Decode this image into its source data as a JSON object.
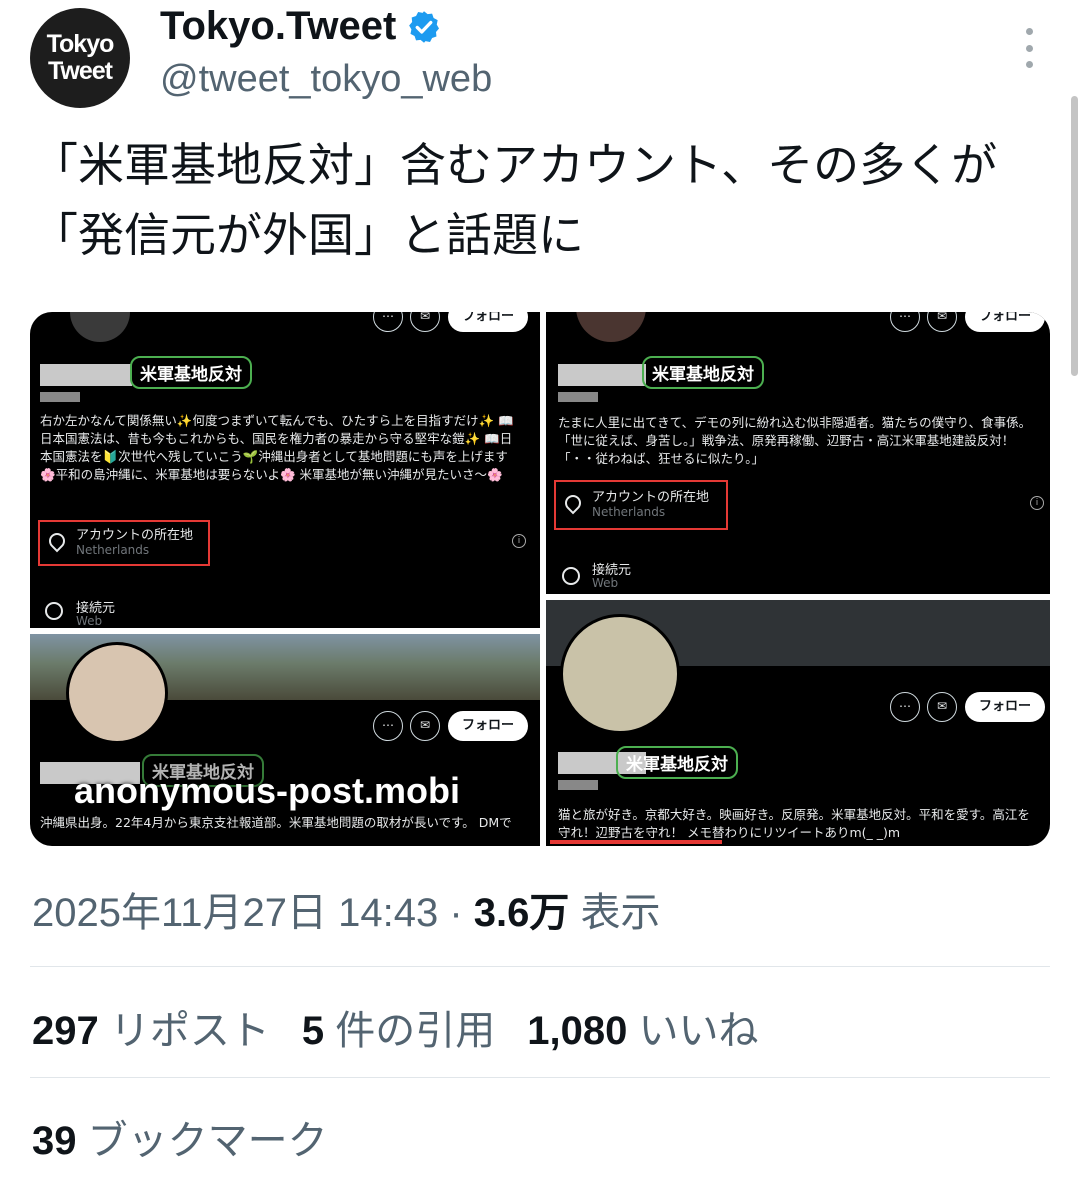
{
  "author": {
    "logo_line1": "Tokyo",
    "logo_line2": "Tweet",
    "display_name": "Tokyo.Tweet",
    "handle": "@tweet_tokyo_web"
  },
  "tweet_text": "「米軍基地反対」含むアカウント、その多くが「発信元が外国」と話題に",
  "media": {
    "tag_label": "米軍基地反対",
    "follow_label": "フォロー",
    "watermark": "anonymous-post.mobi",
    "location_title": "アカウントの所在地",
    "location_value": "Netherlands",
    "connection_title": "接続元",
    "connection_value": "Web",
    "panel1_bio": "右か左かなんて関係無い✨何度つまずいて転んでも、ひたすら上を目指すだけ✨ 📖日本国憲法は、昔も今もこれからも、国民を権力者の暴走から守る堅牢な鎧✨ 📖日本国憲法を🔰次世代へ残していこう🌱沖縄出身者として基地問題にも声を上げます🌸平和の島沖縄に、米軍基地は要らないよ🌸 米軍基地が無い沖縄が見たいさ〜🌸",
    "panel2_bio": "たまに人里に出てきて、デモの列に紛れ込む似非隠遁者。猫たちの僕守り、食事係。「世に従えば、身苦し。」戦争法、原発再稼働、辺野古・高江米軍基地建設反対！「・・従わねば、狂せるに似たり。」",
    "panel3_bio": "沖縄県出身。22年4月から東京支社報道部。米軍基地問題の取材が長いです。 DMで",
    "panel4_bio": "猫と旅が好き。京都大好き。映画好き。反原発。米軍基地反対。平和を愛す。高江を守れ！辺野古を守れ！ メモ替わりにリツイートありm(_ _)m"
  },
  "timestamp": "2025年11月27日 14:43",
  "views_count": "3.6万",
  "views_label": "表示",
  "stats": {
    "reposts_count": "297",
    "reposts_label": "リポスト",
    "quotes_count": "5",
    "quotes_label": "件の引用",
    "likes_count": "1,080",
    "likes_label": "いいね",
    "bookmarks_count": "39",
    "bookmarks_label": "ブックマーク"
  },
  "colors": {
    "verified": "#1d9bf0",
    "highlight_green": "#4caf50",
    "highlight_red": "#e53935"
  }
}
